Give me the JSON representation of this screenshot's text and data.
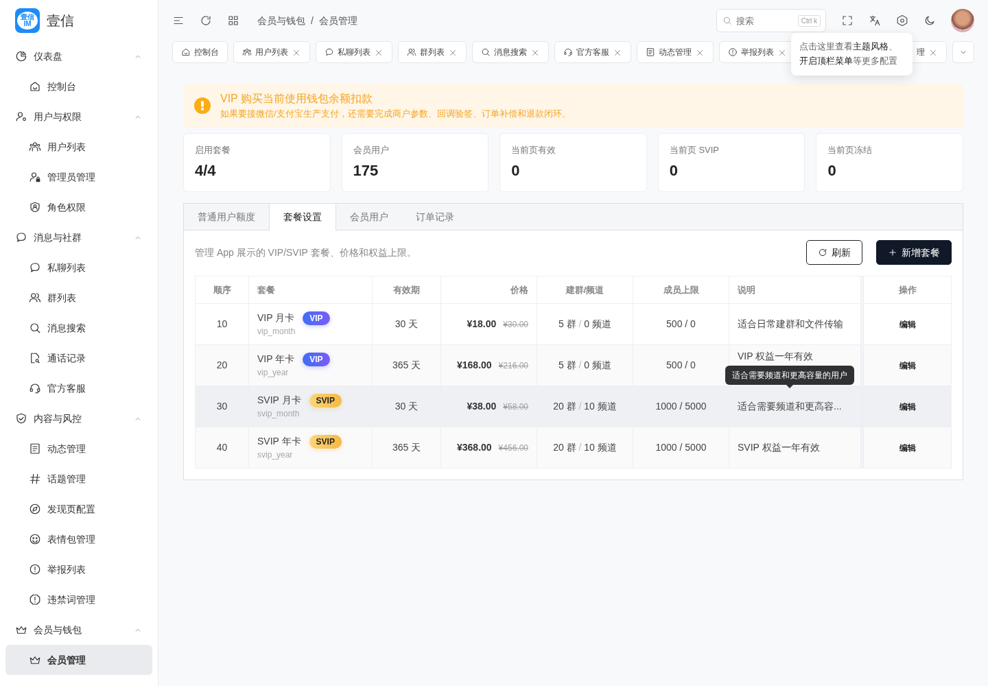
{
  "logo": {
    "mark_text": "壹信",
    "mark_sub": "IM",
    "name": "壹信"
  },
  "sidebar": {
    "groups": [
      {
        "label": "仪表盘",
        "expanded": true,
        "children": [
          {
            "label": "控制台",
            "selected": false
          }
        ]
      },
      {
        "label": "用户与权限",
        "expanded": true,
        "children": [
          {
            "label": "用户列表",
            "selected": false
          },
          {
            "label": "管理员管理",
            "selected": false
          },
          {
            "label": "角色权限",
            "selected": false
          }
        ]
      },
      {
        "label": "消息与社群",
        "expanded": true,
        "children": [
          {
            "label": "私聊列表",
            "selected": false
          },
          {
            "label": "群列表",
            "selected": false
          },
          {
            "label": "消息搜索",
            "selected": false
          },
          {
            "label": "通话记录",
            "selected": false
          },
          {
            "label": "官方客服",
            "selected": false
          }
        ]
      },
      {
        "label": "内容与风控",
        "expanded": true,
        "children": [
          {
            "label": "动态管理",
            "selected": false
          },
          {
            "label": "话题管理",
            "selected": false
          },
          {
            "label": "发现页配置",
            "selected": false
          },
          {
            "label": "表情包管理",
            "selected": false
          },
          {
            "label": "举报列表",
            "selected": false
          },
          {
            "label": "违禁词管理",
            "selected": false
          }
        ]
      },
      {
        "label": "会员与钱包",
        "expanded": true,
        "children": [
          {
            "label": "会员管理",
            "selected": true
          }
        ]
      }
    ]
  },
  "breadcrumb": [
    "会员与钱包",
    "会员管理"
  ],
  "breadcrumb_separator": "/",
  "search": {
    "placeholder": "搜索",
    "shortcut": "Ctrl k"
  },
  "settings_popover": [
    "点击这里查看**主题风格**、",
    "**开启顶栏菜单**等更多配置"
  ],
  "page_tabs": [
    {
      "label": "控制台",
      "closable": false
    },
    {
      "label": "用户列表",
      "closable": true
    },
    {
      "label": "私聊列表",
      "closable": true
    },
    {
      "label": "群列表",
      "closable": true
    },
    {
      "label": "消息搜索",
      "closable": true
    },
    {
      "label": "官方客服",
      "closable": true
    },
    {
      "label": "动态管理",
      "closable": true
    },
    {
      "label": "举报列表",
      "closable": true
    },
    {
      "label": "理",
      "closable": true
    }
  ],
  "alert": {
    "title": "VIP 购买当前使用钱包余额扣款",
    "text": "如果要接微信/支付宝生产支付，还需要完成商户参数、回调验签、订单补偿和退款闭环。"
  },
  "stats": [
    {
      "label": "启用套餐",
      "value": "4/4"
    },
    {
      "label": "会员用户",
      "value": "175"
    },
    {
      "label": "当前页有效",
      "value": "0"
    },
    {
      "label": "当前页 SVIP",
      "value": "0"
    },
    {
      "label": "当前页冻结",
      "value": "0"
    }
  ],
  "tabs": [
    {
      "label": "普通用户额度",
      "selected": false
    },
    {
      "label": "套餐设置",
      "selected": true
    },
    {
      "label": "会员用户",
      "selected": false
    },
    {
      "label": "订单记录",
      "selected": false
    }
  ],
  "panel": {
    "description": "管理 App 展示的 VIP/SVIP 套餐、价格和权益上限。",
    "buttons": [
      {
        "kind": "refresh",
        "label": "刷新"
      },
      {
        "kind": "add",
        "label": "新增套餐"
      }
    ]
  },
  "table": {
    "columns": [
      "顺序",
      "套餐",
      "有效期",
      "价格",
      "建群/频道",
      "成员上限",
      "说明",
      "操作"
    ],
    "rows": [
      {
        "order": "10",
        "name": "VIP 月卡",
        "kind": "vip",
        "badge": "VIP",
        "code": "vip_month",
        "period": "30 天",
        "price": "¥18.00",
        "original_price": "¥30.00",
        "groups": "5 群",
        "separator": "/",
        "channels": "0 频道",
        "members": "500 / 0",
        "description": "适合日常建群和文件传输",
        "action": "编辑",
        "hovered": false
      },
      {
        "order": "20",
        "name": "VIP 年卡",
        "kind": "vip",
        "badge": "VIP",
        "code": "vip_year",
        "period": "365 天",
        "price": "¥168.00",
        "original_price": "¥216.00",
        "groups": "5 群",
        "separator": "/",
        "channels": "0 频道",
        "members": "500 / 0",
        "description": "VIP 权益一年有效",
        "action": "编辑",
        "hovered": false
      },
      {
        "order": "30",
        "name": "SVIP 月卡",
        "kind": "svip",
        "badge": "SVIP",
        "code": "svip_month",
        "period": "30 天",
        "price": "¥38.00",
        "original_price": "¥58.00",
        "groups": "20 群",
        "separator": "/",
        "channels": "10 频道",
        "members": "1000 / 5000",
        "description": "适合需要频道和更高容...",
        "tooltip": "适合需要频道和更高容量的用户",
        "action": "编辑",
        "hovered": true
      },
      {
        "order": "40",
        "name": "SVIP 年卡",
        "kind": "svip",
        "badge": "SVIP",
        "code": "svip_year",
        "period": "365 天",
        "price": "¥368.00",
        "original_price": "¥456.00",
        "groups": "20 群",
        "separator": "/",
        "channels": "10 频道",
        "members": "1000 / 5000",
        "description": "SVIP 权益一年有效",
        "action": "编辑",
        "hovered": false
      }
    ]
  }
}
